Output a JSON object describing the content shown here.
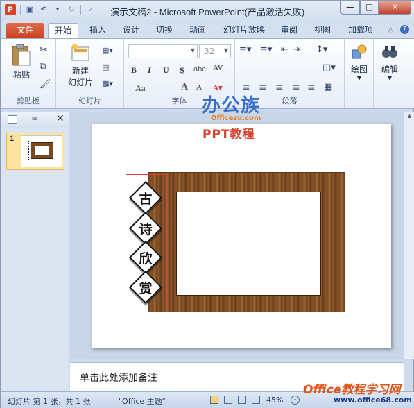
{
  "window": {
    "title": "演示文稿2 - Microsoft PowerPoint(产品激活失败)",
    "app_icon": "P",
    "controls": {
      "minimize": "—",
      "maximize": "□",
      "close": "✕"
    }
  },
  "tabs": [
    {
      "label": "文件"
    },
    {
      "label": "开始"
    },
    {
      "label": "插入"
    },
    {
      "label": "设计"
    },
    {
      "label": "切换"
    },
    {
      "label": "动画"
    },
    {
      "label": "幻灯片放映"
    },
    {
      "label": "审阅"
    },
    {
      "label": "视图"
    },
    {
      "label": "加载项"
    }
  ],
  "ribbon": {
    "clipboard": {
      "paste": "粘贴",
      "group": "剪贴板"
    },
    "slides": {
      "new_slide_line1": "新建",
      "new_slide_line2": "幻灯片",
      "group": "幻灯片"
    },
    "font": {
      "size": "32",
      "group": "字体",
      "bold": "B",
      "italic": "I",
      "underline": "U",
      "strike": "S",
      "spacing": "abc",
      "case": "Aa",
      "grow": "A",
      "shrink": "A"
    },
    "paragraph": {
      "group": "段落"
    },
    "drawing": {
      "label": "绘图"
    },
    "editing": {
      "label": "编辑"
    }
  },
  "slide_panel": {
    "slide_number": "1"
  },
  "slide": {
    "chars": [
      "古",
      "诗",
      "欣",
      "赏"
    ]
  },
  "watermark": {
    "brand": "办公族",
    "site": "Officezu.com",
    "subtitle": "PPT教程",
    "footer_brand": "Office教程学习网",
    "footer_url": "www.office68.com"
  },
  "notes": {
    "placeholder": "单击此处添加备注"
  },
  "status": {
    "slide_info": "幻灯片 第 1 张，共 1 张",
    "theme": "\"Office 主题\"",
    "zoom": "45%"
  }
}
